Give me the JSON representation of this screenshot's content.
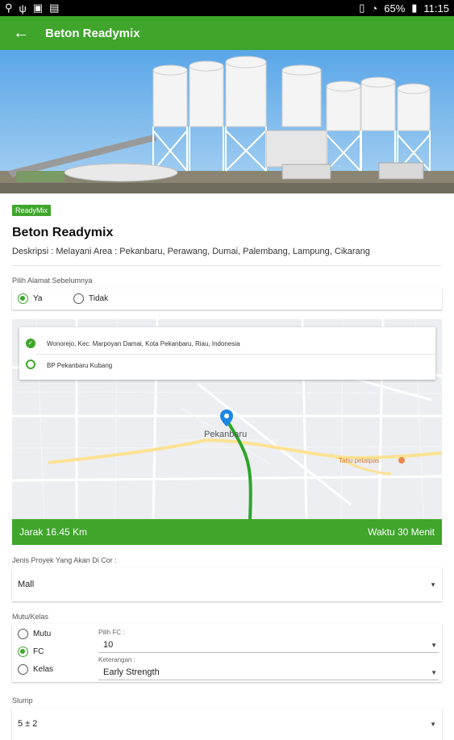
{
  "status_bar": {
    "battery": "65%",
    "time": "11:15"
  },
  "app_bar": {
    "title": "Beton Readymix"
  },
  "product": {
    "badge": "ReadyMix",
    "name": "Beton Readymix",
    "description": "Deskripsi : Melayani Area : Pekanbaru, Perawang, Dumai, Palembang, Lampung, Cikarang"
  },
  "address_choice": {
    "label": "Pilih Alamat Sebelumnya",
    "options": [
      "Ya",
      "Tidak"
    ],
    "selected": "Ya"
  },
  "route": {
    "origin": "Wonorejo, Kec. Marpoyan Damai, Kota Pekanbaru, Riau, Indonesia",
    "destination": "BP Pekanbaru Kubang",
    "map_labels": {
      "city": "Pekanbaru",
      "poi": "Tahu petatpas"
    }
  },
  "distance_bar": {
    "distance": "Jarak 16.45 Km",
    "time": "Waktu 30 Menit"
  },
  "project_type": {
    "label": "Jenis Proyek Yang Akan Di Cor :",
    "value": "Mall"
  },
  "quality": {
    "label": "Mutu/Kelas",
    "options": [
      "Mutu",
      "FC",
      "Kelas"
    ],
    "selected": "FC",
    "fc_label": "Pilih FC :",
    "fc_value": "10",
    "info_label": "Keterangan :",
    "info_value": "Early Strength"
  },
  "slump": {
    "label": "Slump",
    "value": "5 ± 2"
  },
  "colors": {
    "primary": "#3fa52b",
    "route_line": "#2ea52b",
    "marker": "#1e88e5"
  }
}
